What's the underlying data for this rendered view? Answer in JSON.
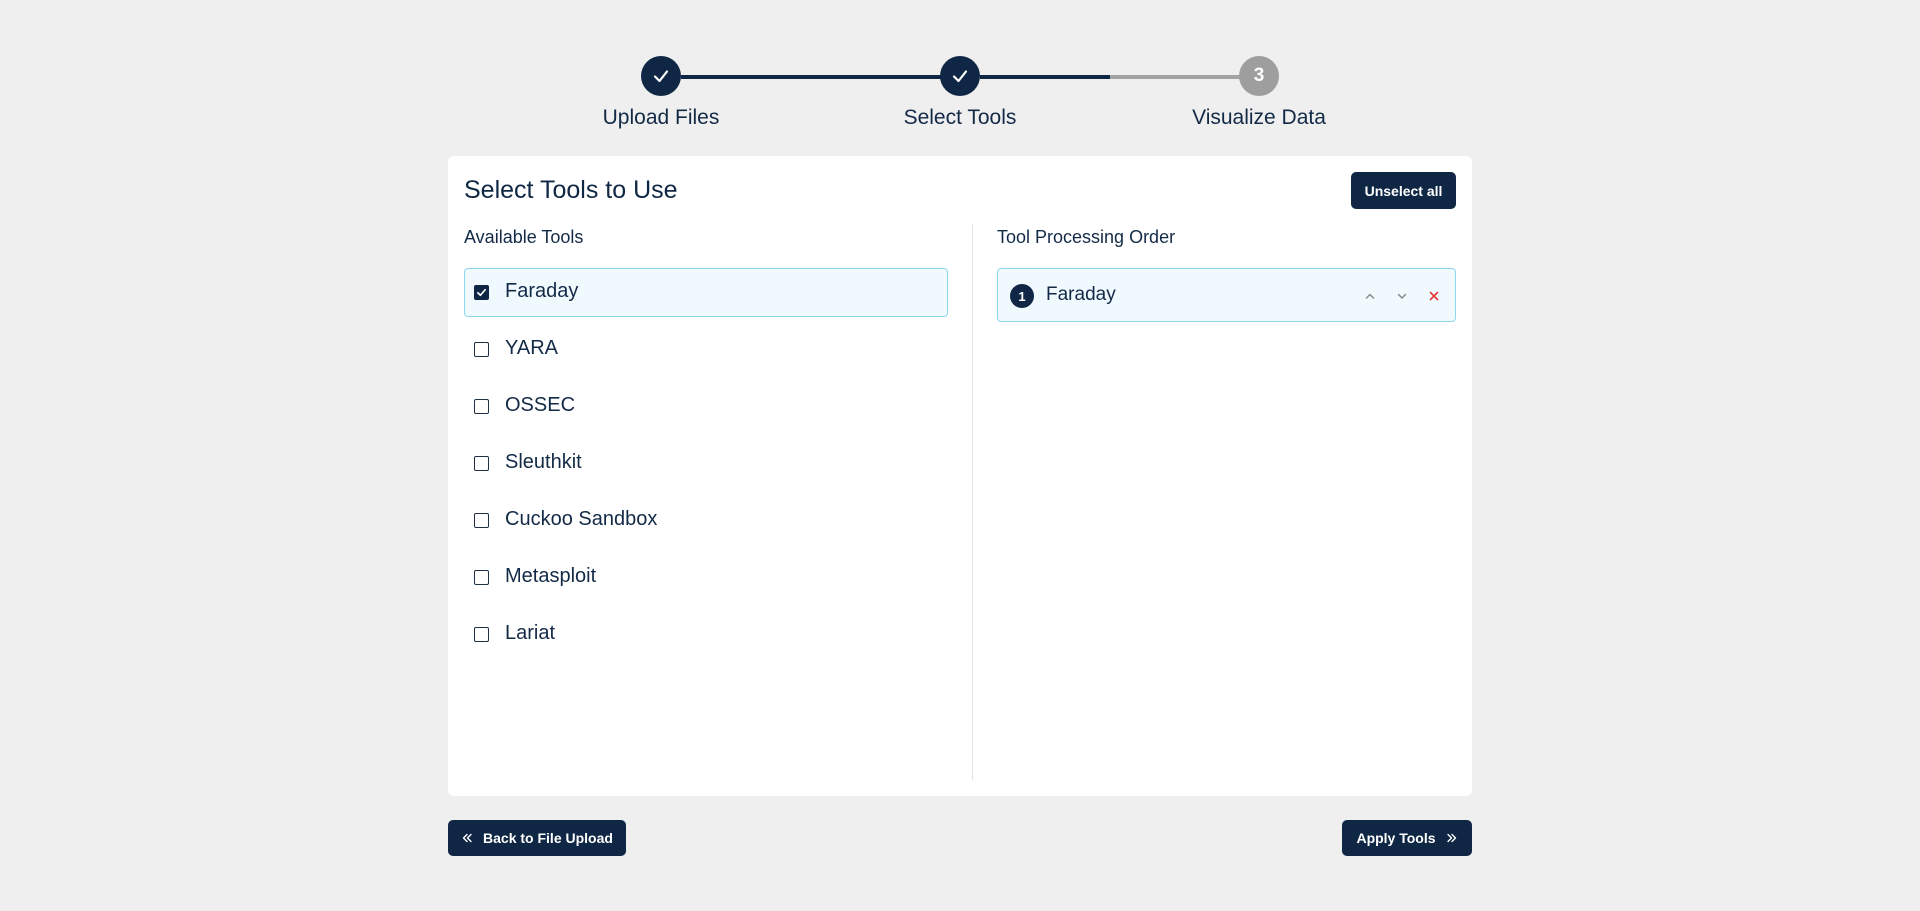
{
  "stepper": {
    "steps": [
      {
        "label": "Upload Files",
        "state": "done"
      },
      {
        "label": "Select Tools",
        "state": "done"
      },
      {
        "label": "Visualize Data",
        "state": "todo",
        "number": "3"
      }
    ]
  },
  "card": {
    "title": "Select Tools to Use",
    "unselect_label": "Unselect all",
    "available_title": "Available Tools",
    "order_title": "Tool Processing Order",
    "tools": [
      {
        "name": "Faraday",
        "checked": true
      },
      {
        "name": "YARA",
        "checked": false
      },
      {
        "name": "OSSEC",
        "checked": false
      },
      {
        "name": "Sleuthkit",
        "checked": false
      },
      {
        "name": "Cuckoo Sandbox",
        "checked": false
      },
      {
        "name": "Metasploit",
        "checked": false
      },
      {
        "name": "Lariat",
        "checked": false
      }
    ],
    "order": [
      {
        "number": "1",
        "name": "Faraday"
      }
    ]
  },
  "footer": {
    "back_label": "Back to File Upload",
    "apply_label": "Apply Tools"
  },
  "colors": {
    "primary": "#0f2744",
    "inactive_step": "#9e9e9e",
    "selected_bg": "#f0f9fe",
    "selected_border": "#8fd7ef",
    "remove": "#e53935",
    "page_bg": "#efefef"
  }
}
